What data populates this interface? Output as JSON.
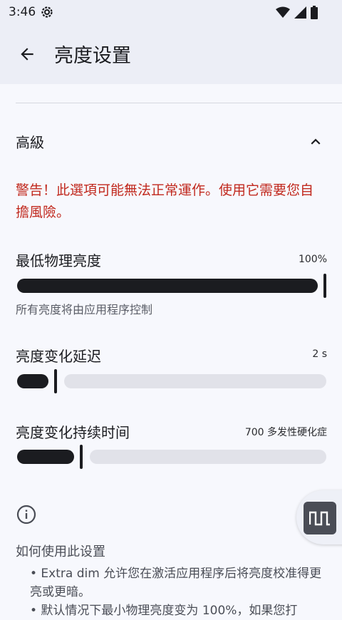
{
  "status_bar": {
    "time": "3:46"
  },
  "app_bar": {
    "title": "亮度设置"
  },
  "section": {
    "title": "高級"
  },
  "warning": {
    "text": "警告！此選項可能無法正常運作。使用它需要您自擔風險。"
  },
  "settings": [
    {
      "label": "最低物理亮度",
      "value": "100%",
      "summary": "所有亮度将由应用程序控制",
      "level": 1.0
    },
    {
      "label": "亮度变化延迟",
      "value": "2 s",
      "level": 0.12
    },
    {
      "label": "亮度变化持续时间",
      "value": "700 多发性硬化症",
      "level": 0.21
    }
  ],
  "info": {
    "title": "如何使用此设置",
    "bullet1": "• Extra dim 允许您在激活应用程序后将亮度校准得更亮或更暗。",
    "bullet2": "• 默认情况下最小物理亮度变为 100%，如果您打"
  },
  "colors": {
    "accent": "#1b1c20",
    "warning": "#c1291e",
    "track": "#e1e2e9",
    "appbar": "#eceef6"
  }
}
